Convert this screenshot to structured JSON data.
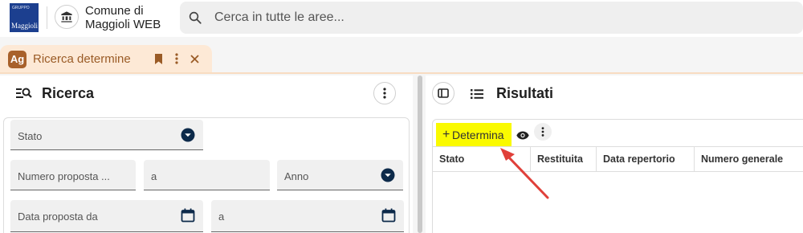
{
  "header": {
    "logo": {
      "small_text": "GRUPPO",
      "big_text": "Maggioli"
    },
    "app_title_line1": "Comune di",
    "app_title_line2": "Maggioli WEB",
    "search": {
      "placeholder": "Cerca in tutte le aree..."
    }
  },
  "tab": {
    "badge": "Ag",
    "label": "Ricerca determine"
  },
  "search_panel": {
    "title": "Ricerca",
    "fields": {
      "stato": "Stato",
      "numero_proposta": "Numero proposta ...",
      "numero_proposta_a": "a",
      "anno": "Anno",
      "data_proposta_da": "Data proposta da",
      "data_proposta_a": "a"
    }
  },
  "results_panel": {
    "title": "Risultati",
    "add_button": {
      "plus": "+",
      "label": "Determina"
    },
    "columns": [
      "Stato",
      "Restituita",
      "Data repertorio",
      "Numero generale"
    ]
  },
  "colors": {
    "tab_bg": "#fde9d6",
    "tab_accent": "#a8612b",
    "highlight": "#fafa00",
    "arrow": "#e0403a",
    "dropdown_icon": "#0d2a4a"
  }
}
